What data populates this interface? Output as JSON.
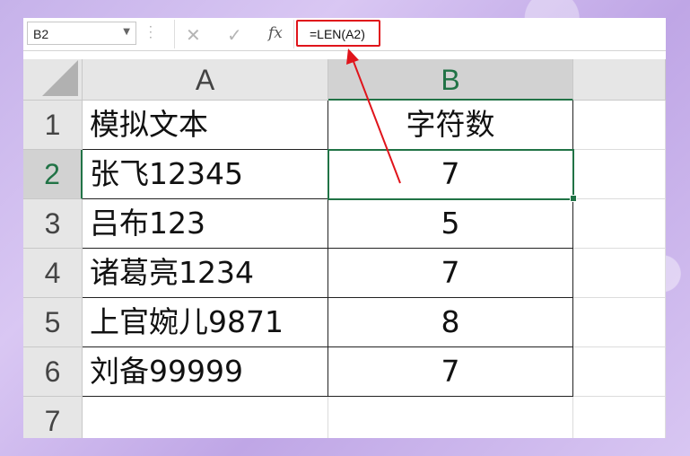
{
  "name_box": {
    "value": "B2"
  },
  "formula_bar": {
    "cancel_icon": "x-icon",
    "enter_icon": "check-icon",
    "fx_label": "fx",
    "formula": "=LEN(A2)"
  },
  "columns": [
    {
      "label": "A"
    },
    {
      "label": "B"
    }
  ],
  "rows": [
    {
      "num": "1",
      "a": "模拟文本",
      "b": "字符数"
    },
    {
      "num": "2",
      "a": "张飞12345",
      "b": "7"
    },
    {
      "num": "3",
      "a": "吕布123",
      "b": "5"
    },
    {
      "num": "4",
      "a": "诸葛亮1234",
      "b": "7"
    },
    {
      "num": "5",
      "a": "上官婉儿9871",
      "b": "8"
    },
    {
      "num": "6",
      "a": "刘备99999",
      "b": "7"
    },
    {
      "num": "7",
      "a": "",
      "b": ""
    }
  ],
  "selected_cell": "B2",
  "colors": {
    "accent": "#217346",
    "highlight": "#e0141b"
  }
}
